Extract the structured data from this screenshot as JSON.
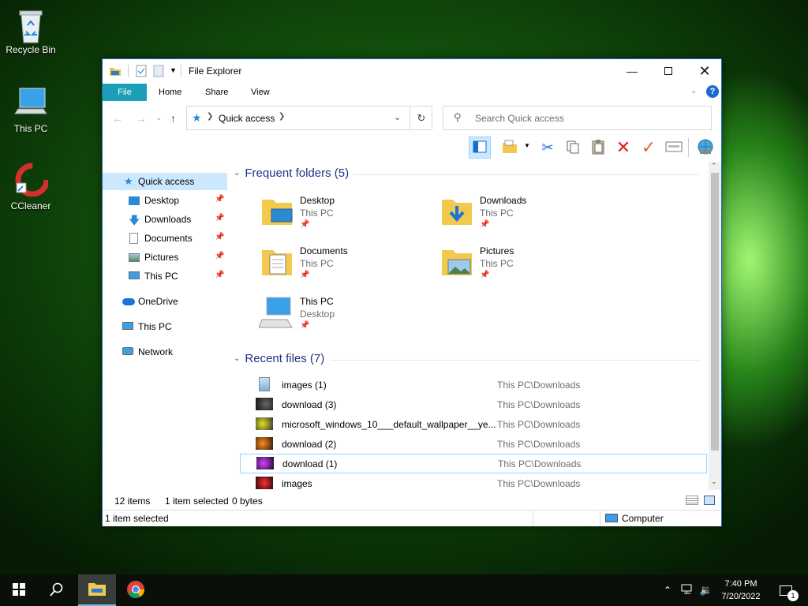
{
  "desktop": {
    "icons": [
      {
        "label": "Recycle Bin",
        "icon": "recycle-bin-icon"
      },
      {
        "label": "This PC",
        "icon": "this-pc-icon"
      },
      {
        "label": "CCleaner",
        "icon": "ccleaner-icon"
      }
    ]
  },
  "window": {
    "title": "File Explorer",
    "ribbon_tabs": [
      "File",
      "Home",
      "Share",
      "View"
    ],
    "address": {
      "crumb": "Quick access"
    },
    "search_placeholder": "Search Quick access",
    "nav": {
      "quick_access": "Quick access",
      "pinned": [
        "Desktop",
        "Downloads",
        "Documents",
        "Pictures",
        "This PC"
      ],
      "onedrive": "OneDrive",
      "this_pc": "This PC",
      "network": "Network"
    },
    "frequent": {
      "header": "Frequent folders (5)",
      "folders": [
        {
          "name": "Desktop",
          "location": "This PC"
        },
        {
          "name": "Downloads",
          "location": "This PC"
        },
        {
          "name": "Documents",
          "location": "This PC"
        },
        {
          "name": "Pictures",
          "location": "This PC"
        },
        {
          "name": "This PC",
          "location": "Desktop"
        }
      ]
    },
    "recent": {
      "header": "Recent files (7)",
      "files": [
        {
          "name": "images (1)",
          "path": "This PC\\Downloads",
          "thumb": "#cfe3f5"
        },
        {
          "name": "download (3)",
          "path": "This PC\\Downloads",
          "thumb": "#2a2a2a"
        },
        {
          "name": "microsoft_windows_10___default_wallpaper__ye...",
          "path": "This PC\\Downloads",
          "thumb": "#8a8a10"
        },
        {
          "name": "download (2)",
          "path": "This PC\\Downloads",
          "thumb": "#7a3a10"
        },
        {
          "name": "download (1)",
          "path": "This PC\\Downloads",
          "thumb": "#6a1a8a"
        },
        {
          "name": "images",
          "path": "This PC\\Downloads",
          "thumb": "#8a1010"
        }
      ]
    },
    "status": {
      "items": "12 items",
      "selected": "1 item selected",
      "size": "0 bytes",
      "bar_left": "1 item selected",
      "bar_right": "Computer"
    }
  },
  "taskbar": {
    "time": "7:40 PM",
    "date": "7/20/2022",
    "notif_count": "1"
  }
}
